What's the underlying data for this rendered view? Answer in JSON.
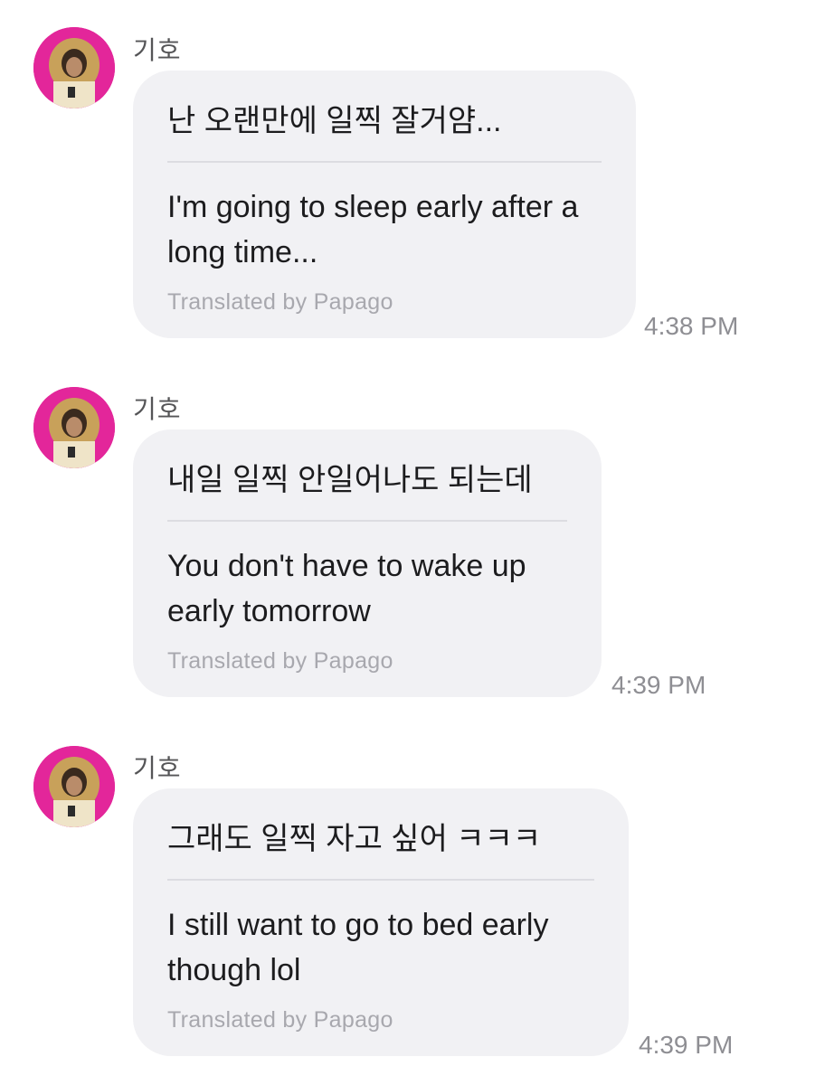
{
  "messages": [
    {
      "sender": "기호",
      "original": "난 오랜만에 일찍 잘거얌...",
      "translated": "I'm going to sleep early after a long time...",
      "credit": "Translated by Papago",
      "time": "4:38 PM"
    },
    {
      "sender": "기호",
      "original": "내일 일찍 안일어나도 되는데",
      "translated": "You don't have to wake up early tomorrow",
      "credit": "Translated by Papago",
      "time": "4:39 PM"
    },
    {
      "sender": "기호",
      "original": "그래도 일찍 자고 싶어 ㅋㅋㅋ",
      "translated": "I still want to go to bed early though lol",
      "credit": "Translated by Papago",
      "time": "4:39 PM"
    }
  ],
  "colors": {
    "bubble": "#f1f1f4",
    "avatar_bg": "#e3269a",
    "meta_text": "#8e8e93"
  }
}
